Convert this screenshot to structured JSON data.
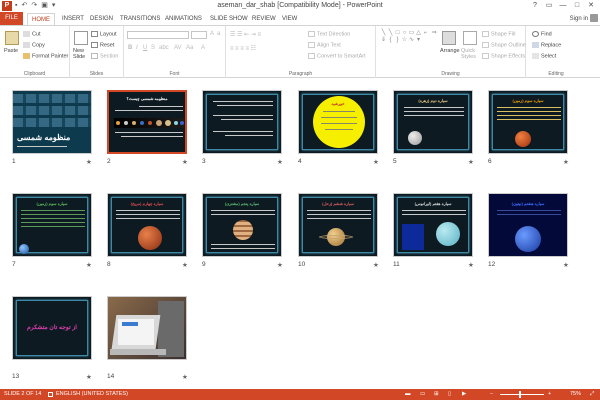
{
  "window": {
    "title": "aseman_dar_shab [Compatibility Mode] - PowerPoint",
    "app_icon": "P",
    "qat_icons": [
      "save-icon",
      "undo-icon",
      "redo-icon",
      "present-icon",
      "customize-icon"
    ],
    "controls": [
      "?",
      "▭",
      "—",
      "□",
      "✕"
    ]
  },
  "ribbon_tabs": {
    "file": "FILE",
    "home": "HOME",
    "insert": "INSERT",
    "design": "DESIGN",
    "transitions": "TRANSITIONS",
    "animations": "ANIMATIONS",
    "slideshow": "SLIDE SHOW",
    "review": "REVIEW",
    "view": "VIEW",
    "signin": "Sign in"
  },
  "ribbon": {
    "clipboard": {
      "label": "Clipboard",
      "paste": "Paste",
      "cut": "Cut",
      "copy": "Copy",
      "format_painter": "Format Painter"
    },
    "slides": {
      "label": "Slides",
      "new_slide": "New Slide",
      "layout": "Layout",
      "reset": "Reset",
      "section": "Section"
    },
    "font": {
      "label": "Font"
    },
    "paragraph": {
      "label": "Paragraph",
      "text_direction": "Text Direction",
      "align_text": "Align Text",
      "convert": "Convert to SmartArt"
    },
    "drawing": {
      "label": "Drawing",
      "arrange": "Arrange",
      "quick_styles": "Quick Styles",
      "shape_fill": "Shape Fill",
      "shape_outline": "Shape Outline",
      "shape_effects": "Shape Effects"
    },
    "editing": {
      "label": "Editing",
      "find": "Find",
      "replace": "Replace",
      "select": "Select"
    }
  },
  "slides": [
    {
      "num": "1",
      "title": "منظومه شمسی",
      "star": "★"
    },
    {
      "num": "2",
      "title": "منظومه شمسی چیست؟",
      "star": "★"
    },
    {
      "num": "3",
      "title": "",
      "star": "★"
    },
    {
      "num": "4",
      "title": "خورشید",
      "star": "★"
    },
    {
      "num": "5",
      "title": "سیاره دوم (زهره)",
      "star": "★"
    },
    {
      "num": "6",
      "title": "سیاره سوم (زمین)",
      "star": "★"
    },
    {
      "num": "7",
      "title": "سیاره سوم (زمین)",
      "star": "★"
    },
    {
      "num": "8",
      "title": "سیاره چهارم (مریخ)",
      "star": "★"
    },
    {
      "num": "9",
      "title": "سیاره پنجم (مشتری)",
      "star": "★"
    },
    {
      "num": "10",
      "title": "سیاره ششم (زحل)",
      "star": "★"
    },
    {
      "num": "11",
      "title": "سیاره هفتم (اورانوس)",
      "star": "★"
    },
    {
      "num": "12",
      "title": "سیاره هشتم (نپتون)",
      "star": "★"
    },
    {
      "num": "13",
      "title": "از توجه تان متشکرم",
      "star": "★"
    },
    {
      "num": "14",
      "title": "",
      "star": "★"
    }
  ],
  "status": {
    "slide_of": "SLIDE 2 OF 14",
    "language": "ENGLISH (UNITED STATES)",
    "zoom": "75%"
  }
}
